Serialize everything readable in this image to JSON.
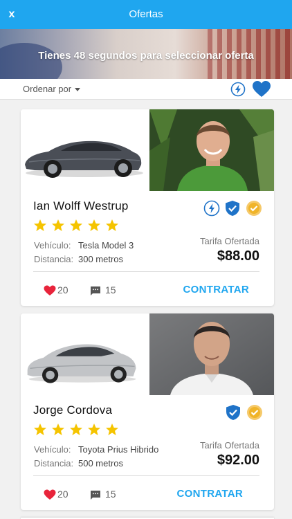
{
  "header": {
    "close_label": "x",
    "title": "Ofertas"
  },
  "banner": {
    "message": "Tienes 48 segundos para seleccionar oferta"
  },
  "sortbar": {
    "sort_label": "Ordenar por",
    "icons": [
      "bolt-filter-icon",
      "heart-filter-icon"
    ]
  },
  "colors": {
    "primary": "#1fa6ef",
    "star": "#f5c400",
    "heart": "#e8243b",
    "shield": "#1f73c8",
    "medal": "#f0b429"
  },
  "offers": [
    {
      "name": "Ian Wolff Westrup",
      "badges": [
        "bolt-badge-icon",
        "shield-badge-icon",
        "medal-badge-icon"
      ],
      "rating": 5,
      "vehicle_label": "Vehículo:",
      "vehicle": "Tesla Model 3",
      "distance_label": "Distancia:",
      "distance": "300 metros",
      "fare_label": "Tarifa Ofertada",
      "fare": "$88.00",
      "likes": "20",
      "comments": "15",
      "action": "CONTRATAR"
    },
    {
      "name": "Jorge Cordova",
      "badges": [
        "shield-badge-icon",
        "medal-badge-icon"
      ],
      "rating": 5,
      "vehicle_label": "Vehículo:",
      "vehicle": "Toyota Prius Hibrido",
      "distance_label": "Distancia:",
      "distance": "500 metros",
      "fare_label": "Tarifa Ofertada",
      "fare": "$92.00",
      "likes": "20",
      "comments": "15",
      "action": "CONTRATAR"
    }
  ]
}
